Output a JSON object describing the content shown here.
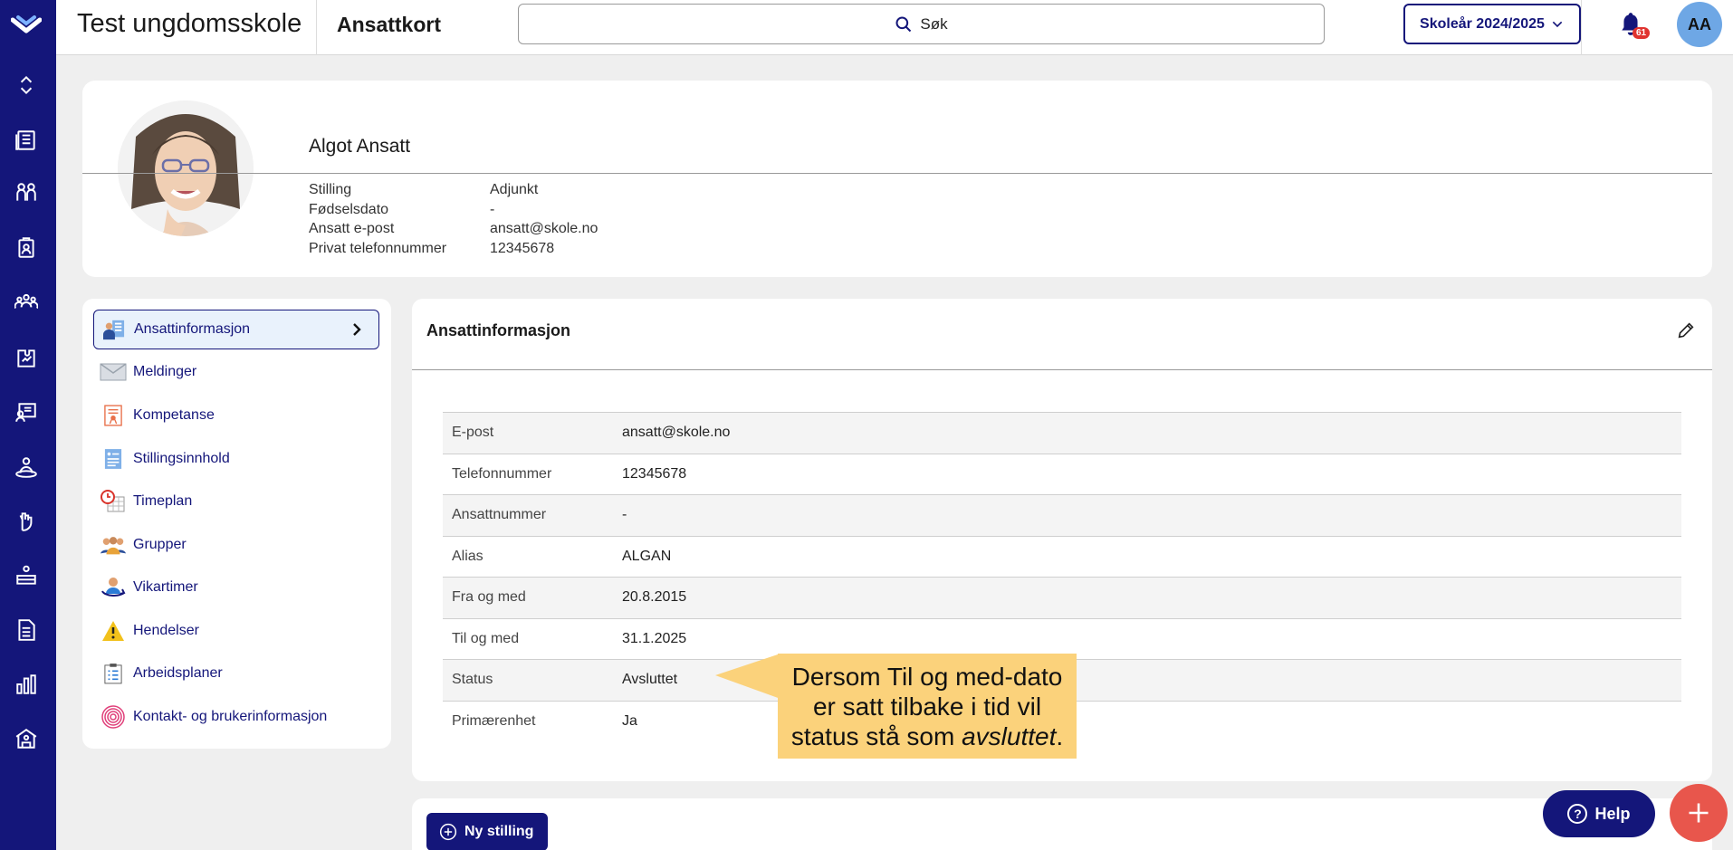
{
  "app": {
    "school_name": "Test ungdomsskole",
    "page_title": "Ansattkort"
  },
  "search": {
    "label": "Søk"
  },
  "year_selector": {
    "label": "Skoleår 2024/2025"
  },
  "notifications": {
    "count": "61"
  },
  "user": {
    "initials": "AA"
  },
  "rail_icons": [
    "logo-icon",
    "collapse-icon",
    "news-icon",
    "students-icon",
    "clipboard-icon",
    "groups-icon",
    "puzzle-icon",
    "presentation-icon",
    "person-icon",
    "hand-icon",
    "desk-icon",
    "document-icon",
    "chart-icon",
    "school-icon"
  ],
  "profile": {
    "name": "Algot Ansatt",
    "fields": [
      {
        "label": "Stilling",
        "value": "Adjunkt"
      },
      {
        "label": "Fødselsdato",
        "value": "-"
      },
      {
        "label": "Ansatt e-post",
        "value": "ansatt@skole.no"
      },
      {
        "label": "Privat telefonnummer",
        "value": "12345678"
      }
    ]
  },
  "menu": {
    "items": [
      {
        "label": "Ansattinformasjon",
        "icon": "employee-info-icon",
        "active": true
      },
      {
        "label": "Meldinger",
        "icon": "envelope-icon"
      },
      {
        "label": "Kompetanse",
        "icon": "certificate-icon"
      },
      {
        "label": "Stillingsinnhold",
        "icon": "job-content-icon"
      },
      {
        "label": "Timeplan",
        "icon": "timetable-icon"
      },
      {
        "label": "Grupper",
        "icon": "groups-icon"
      },
      {
        "label": "Vikartimer",
        "icon": "substitute-icon"
      },
      {
        "label": "Hendelser",
        "icon": "warning-icon"
      },
      {
        "label": "Arbeidsplaner",
        "icon": "checklist-icon"
      },
      {
        "label": "Kontakt- og brukerinformasjon",
        "icon": "fingerprint-icon"
      }
    ]
  },
  "info": {
    "title": "Ansattinformasjon",
    "rows": [
      {
        "label": "E-post",
        "value": "ansatt@skole.no"
      },
      {
        "label": "Telefonnummer",
        "value": "12345678"
      },
      {
        "label": "Ansattnummer",
        "value": "-"
      },
      {
        "label": "Alias",
        "value": "ALGAN"
      },
      {
        "label": "Fra og med",
        "value": "20.8.2015"
      },
      {
        "label": "Til og med",
        "value": "31.1.2025"
      },
      {
        "label": "Status",
        "value": "Avsluttet"
      },
      {
        "label": "Primærenhet",
        "value": "Ja"
      }
    ]
  },
  "callout": {
    "line1": "Dersom Til og med-dato",
    "line2": "er satt tilbake i tid vil",
    "line3_prefix": "status stå som ",
    "line3_em": "avsluttet",
    "line3_suffix": "."
  },
  "actions": {
    "new_position": "Ny stilling",
    "help": "Help"
  },
  "colors": {
    "navy": "#14167a",
    "accent_red": "#e8564c",
    "callout": "#fbd27b",
    "avatar_blue": "#6ea7e5"
  }
}
